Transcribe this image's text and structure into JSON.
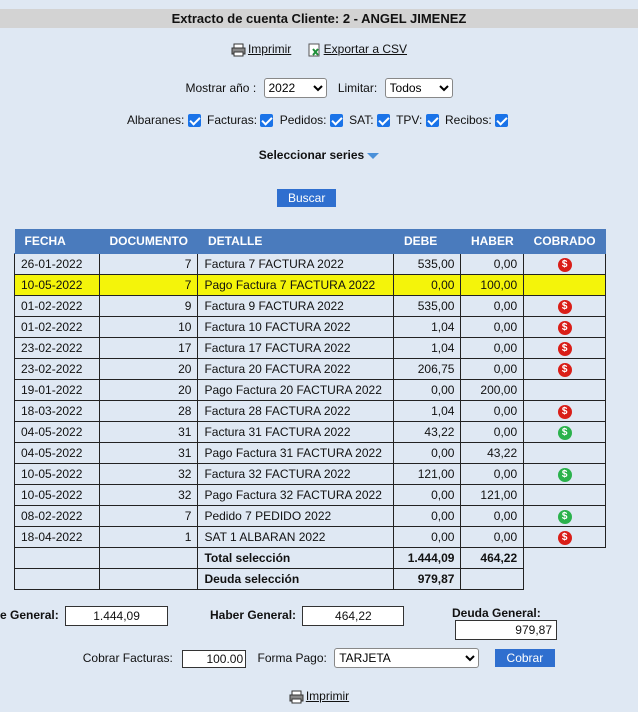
{
  "title": "Extracto de cuenta Cliente: 2 - ANGEL JIMENEZ",
  "toolbar": {
    "print_label": "Imprimir",
    "export_label": "Exportar a CSV"
  },
  "filters": {
    "year_label": "Mostrar año :",
    "year_value": "2022",
    "limit_label": "Limitar:",
    "limit_value": "Todos",
    "types": [
      {
        "label": "Albaranes:"
      },
      {
        "label": "Facturas:"
      },
      {
        "label": "Pedidos:"
      },
      {
        "label": "SAT:"
      },
      {
        "label": "TPV:"
      },
      {
        "label": "Recibos:"
      }
    ],
    "series_label": "Seleccionar series",
    "search_label": "Buscar"
  },
  "table": {
    "headers": [
      "FECHA",
      "DOCUMENTO",
      "DETALLE",
      "DEBE",
      "HABER",
      "COBRADO"
    ],
    "rows": [
      {
        "fecha": "26-01-2022",
        "doc": "7",
        "detalle": "Factura 7 FACTURA 2022",
        "debe": "535,00",
        "haber": "0,00",
        "cobrado": "red"
      },
      {
        "fecha": "10-05-2022",
        "doc": "7",
        "detalle": "Pago Factura 7 FACTURA 2022",
        "debe": "0,00",
        "haber": "100,00",
        "cobrado": ""
      },
      {
        "fecha": "01-02-2022",
        "doc": "9",
        "detalle": "Factura 9 FACTURA 2022",
        "debe": "535,00",
        "haber": "0,00",
        "cobrado": "red"
      },
      {
        "fecha": "01-02-2022",
        "doc": "10",
        "detalle": "Factura 10 FACTURA 2022",
        "debe": "1,04",
        "haber": "0,00",
        "cobrado": "red"
      },
      {
        "fecha": "23-02-2022",
        "doc": "17",
        "detalle": "Factura 17 FACTURA 2022",
        "debe": "1,04",
        "haber": "0,00",
        "cobrado": "red"
      },
      {
        "fecha": "23-02-2022",
        "doc": "20",
        "detalle": "Factura 20 FACTURA 2022",
        "debe": "206,75",
        "haber": "0,00",
        "cobrado": "red"
      },
      {
        "fecha": "19-01-2022",
        "doc": "20",
        "detalle": "Pago Factura 20 FACTURA 2022",
        "debe": "0,00",
        "haber": "200,00",
        "cobrado": ""
      },
      {
        "fecha": "18-03-2022",
        "doc": "28",
        "detalle": "Factura 28 FACTURA 2022",
        "debe": "1,04",
        "haber": "0,00",
        "cobrado": "red"
      },
      {
        "fecha": "04-05-2022",
        "doc": "31",
        "detalle": "Factura 31 FACTURA 2022",
        "debe": "43,22",
        "haber": "0,00",
        "cobrado": "green"
      },
      {
        "fecha": "04-05-2022",
        "doc": "31",
        "detalle": "Pago Factura 31 FACTURA 2022",
        "debe": "0,00",
        "haber": "43,22",
        "cobrado": ""
      },
      {
        "fecha": "10-05-2022",
        "doc": "32",
        "detalle": "Factura 32 FACTURA 2022",
        "debe": "121,00",
        "haber": "0,00",
        "cobrado": "green"
      },
      {
        "fecha": "10-05-2022",
        "doc": "32",
        "detalle": "Pago Factura 32 FACTURA 2022",
        "debe": "0,00",
        "haber": "121,00",
        "cobrado": ""
      },
      {
        "fecha": "08-02-2022",
        "doc": "7",
        "detalle": "Pedido 7 PEDIDO 2022",
        "debe": "0,00",
        "haber": "0,00",
        "cobrado": "green"
      },
      {
        "fecha": "18-04-2022",
        "doc": "1",
        "detalle": "SAT 1 ALBARAN 2022",
        "debe": "0,00",
        "haber": "0,00",
        "cobrado": "red"
      }
    ],
    "total_label": "Total selección",
    "total_debe": "1.444,09",
    "total_haber": "464,22",
    "deuda_label": "Deuda selección",
    "deuda_value": "979,87"
  },
  "general": {
    "debe_label": "e General:",
    "debe_value": "1.444,09",
    "haber_label": "Haber General:",
    "haber_value": "464,22",
    "deuda_label": "Deuda General:",
    "deuda_value": "979,87"
  },
  "payment": {
    "cobrar_label": "Cobrar Facturas:",
    "cobrar_value": "100.00",
    "forma_label": "Forma Pago:",
    "forma_value": "TARJETA",
    "cobrar_button": "Cobrar"
  },
  "footer": {
    "print_label": "Imprimir"
  },
  "colors": {
    "header_bg": "#4a7bbd",
    "highlight": "#f4f40a",
    "button": "#2f6fcf",
    "coin_red": "#d91e18",
    "coin_green": "#2bb24c"
  }
}
